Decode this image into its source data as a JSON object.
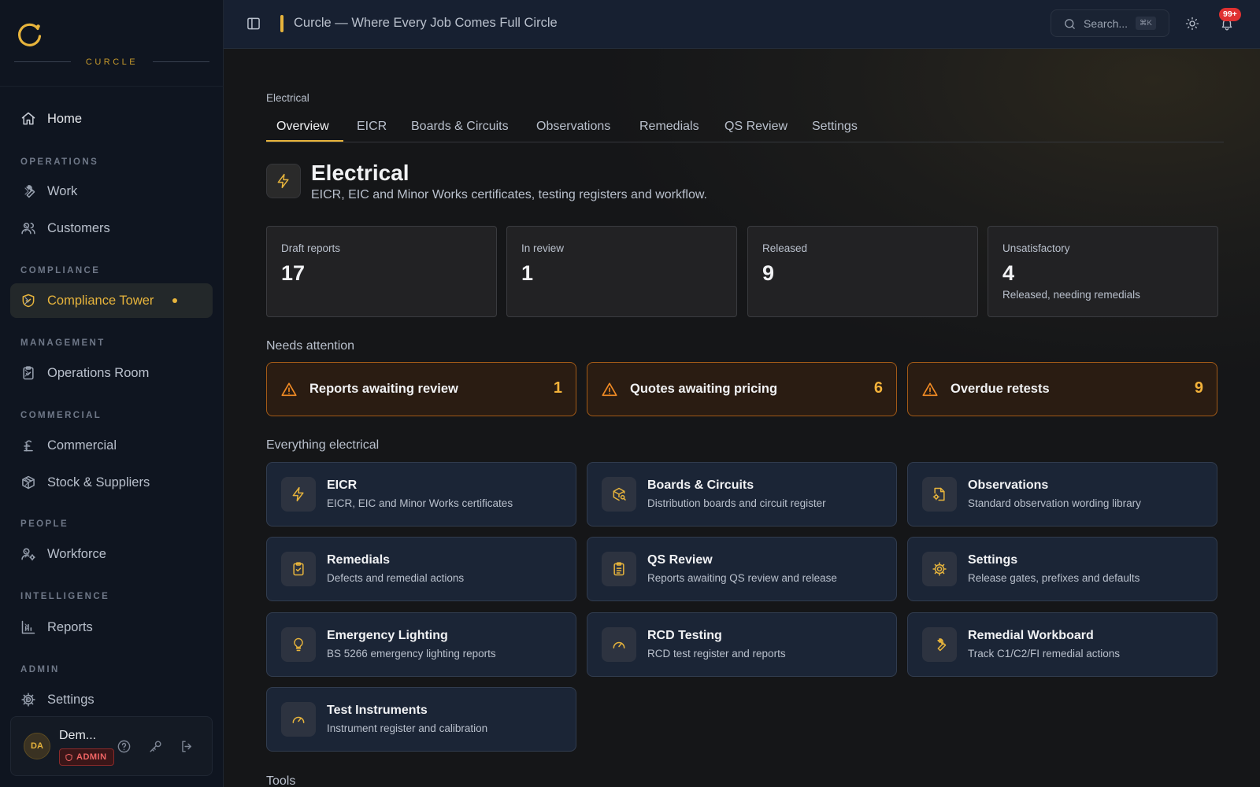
{
  "brand": {
    "name": "CURCLE"
  },
  "sidebar": {
    "home": "Home",
    "sections": [
      "OPERATIONS",
      "COMPLIANCE",
      "MANAGEMENT",
      "COMMERCIAL",
      "PEOPLE",
      "INTELLIGENCE",
      "ADMIN"
    ],
    "items": [
      {
        "label": "Work",
        "icon": "wrench-icon"
      },
      {
        "label": "Customers",
        "icon": "users-icon"
      },
      {
        "label": "Compliance Tower",
        "icon": "shield-check-icon",
        "active": true
      },
      {
        "label": "Operations Room",
        "icon": "clipboard-check-icon"
      },
      {
        "label": "Commercial",
        "icon": "pound-icon"
      },
      {
        "label": "Stock & Suppliers",
        "icon": "package-icon"
      },
      {
        "label": "Workforce",
        "icon": "user-cog-icon"
      },
      {
        "label": "Reports",
        "icon": "bar-chart-icon"
      },
      {
        "label": "Settings",
        "icon": "gear-icon"
      }
    ],
    "user": {
      "initials": "DA",
      "name": "Dem...",
      "role": "ADMIN"
    }
  },
  "topbar": {
    "title": "Curcle — Where Every Job Comes Full Circle",
    "search_placeholder": "Search...",
    "shortcut": "⌘K",
    "notifications": "99+"
  },
  "page": {
    "breadcrumb": "Electrical",
    "tabs": [
      "Overview",
      "EICR",
      "Boards & Circuits",
      "Observations",
      "Remedials",
      "QS Review",
      "Settings"
    ],
    "active_tab": "Overview",
    "title": "Electrical",
    "subtitle": "EICR, EIC and Minor Works certificates, testing registers and workflow.",
    "stats": [
      {
        "label": "Draft reports",
        "value": "17",
        "note": ""
      },
      {
        "label": "In review",
        "value": "1",
        "note": ""
      },
      {
        "label": "Released",
        "value": "9",
        "note": ""
      },
      {
        "label": "Unsatisfactory",
        "value": "4",
        "note": "Released, needing remedials"
      }
    ],
    "attention_title": "Needs attention",
    "alerts": [
      {
        "label": "Reports awaiting review",
        "count": "1"
      },
      {
        "label": "Quotes awaiting pricing",
        "count": "6"
      },
      {
        "label": "Overdue retests",
        "count": "9"
      }
    ],
    "everything_title": "Everything electrical",
    "cards": [
      {
        "title": "EICR",
        "subtitle": "EICR, EIC and Minor Works certificates",
        "icon": "lightning-icon"
      },
      {
        "title": "Boards & Circuits",
        "subtitle": "Distribution boards and circuit register",
        "icon": "package-search-icon"
      },
      {
        "title": "Observations",
        "subtitle": "Standard observation wording library",
        "icon": "file-cog-icon"
      },
      {
        "title": "Remedials",
        "subtitle": "Defects and remedial actions",
        "icon": "clipboard-check-icon"
      },
      {
        "title": "QS Review",
        "subtitle": "Reports awaiting QS review and release",
        "icon": "clipboard-list-icon"
      },
      {
        "title": "Settings",
        "subtitle": "Release gates, prefixes and defaults",
        "icon": "gear-icon"
      },
      {
        "title": "Emergency Lighting",
        "subtitle": "BS 5266 emergency lighting reports",
        "icon": "lightbulb-icon"
      },
      {
        "title": "RCD Testing",
        "subtitle": "RCD test register and reports",
        "icon": "gauge-icon"
      },
      {
        "title": "Remedial Workboard",
        "subtitle": "Track C1/C2/FI remedial actions",
        "icon": "wrench-icon"
      },
      {
        "title": "Test Instruments",
        "subtitle": "Instrument register and calibration",
        "icon": "gauge-icon"
      }
    ],
    "tools_title": "Tools"
  },
  "colors": {
    "accent": "#e7b43c",
    "warning": "#f08a24",
    "danger": "#e03131"
  }
}
